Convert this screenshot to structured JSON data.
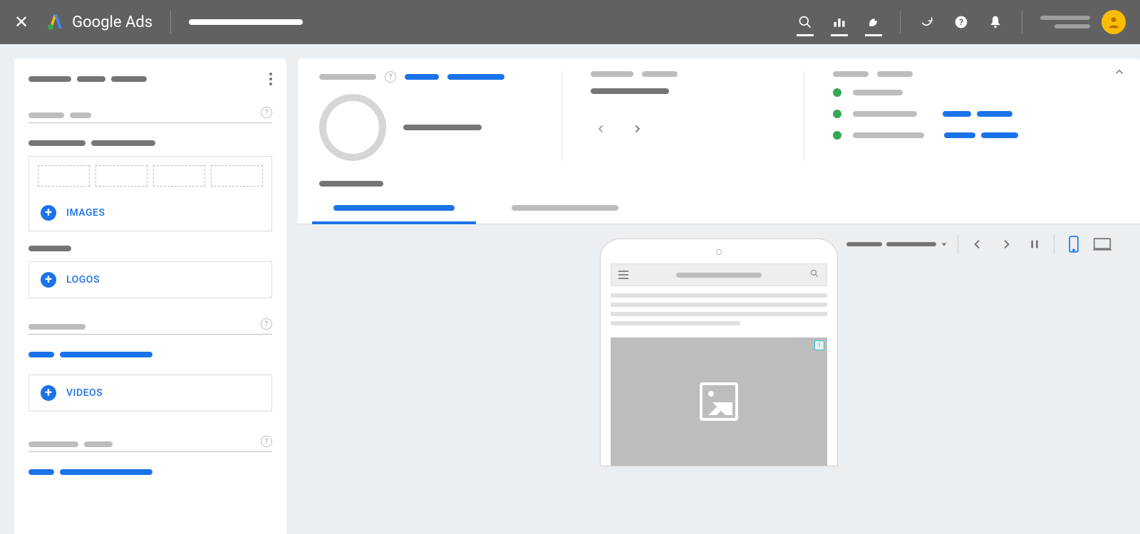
{
  "header": {
    "brand": "Google Ads",
    "colors": {
      "brand_yellow": "#fbbc04",
      "brand_blue": "#4285f4",
      "brand_green": "#34a853"
    }
  },
  "left_panel": {
    "assets": {
      "images": {
        "label": "IMAGES"
      },
      "logos": {
        "label": "LOGOS"
      },
      "videos": {
        "label": "VIDEOS"
      }
    }
  },
  "summary": {
    "ad_strength": {
      "ring_color": "#d6d6d6"
    },
    "checklist": [
      {
        "status": "ok"
      },
      {
        "status": "ok"
      },
      {
        "status": "ok"
      }
    ]
  },
  "tabs": {
    "active_index": 0
  },
  "preview_toolbar": {
    "device": "mobile"
  },
  "colors": {
    "primary": "#1a73e8",
    "text_dark": "#616161",
    "text_light": "#bdbdbd",
    "success": "#34a853"
  }
}
